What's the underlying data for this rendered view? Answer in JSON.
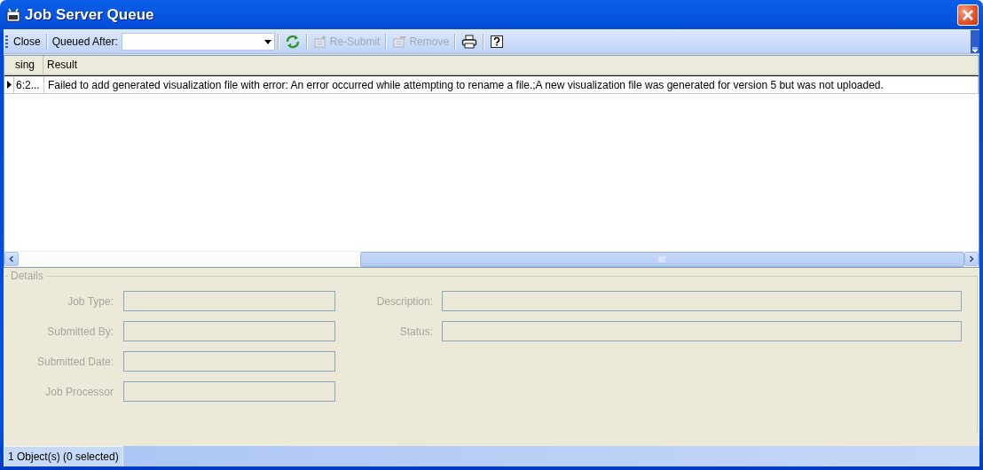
{
  "window": {
    "title": "Job Server Queue"
  },
  "toolbar": {
    "close_button": {
      "label": "Close"
    },
    "queued_after": {
      "label": "Queued After:"
    },
    "buttons": [
      {
        "kind": "refresh"
      },
      {
        "kind": "resubmit",
        "label": "Re-Submit",
        "disabled": true
      },
      {
        "kind": "remove",
        "label": "Remove",
        "disabled": true
      },
      {
        "kind": "print"
      },
      {
        "kind": "help"
      }
    ]
  },
  "table": {
    "columns": [
      "sing",
      "Result"
    ],
    "rows": [
      {
        "current": true,
        "cells": [
          "6:2...",
          "Failed to add generated visualization file with error: An error occurred while attempting to rename a file.;A new visualization file was generated for version 5 but was not uploaded."
        ]
      }
    ]
  },
  "details": {
    "title": "Details",
    "disabled": true,
    "left_fields": [
      {
        "label": "Job Type:"
      },
      {
        "label": "Submitted By:"
      },
      {
        "label": "Submitted Date:"
      },
      {
        "label": "Job Processor"
      }
    ],
    "right_fields": [
      {
        "label": "Description:"
      },
      {
        "label": "Status:"
      }
    ]
  },
  "status_bar": {
    "text": "1 Object(s) (0 selected)"
  }
}
